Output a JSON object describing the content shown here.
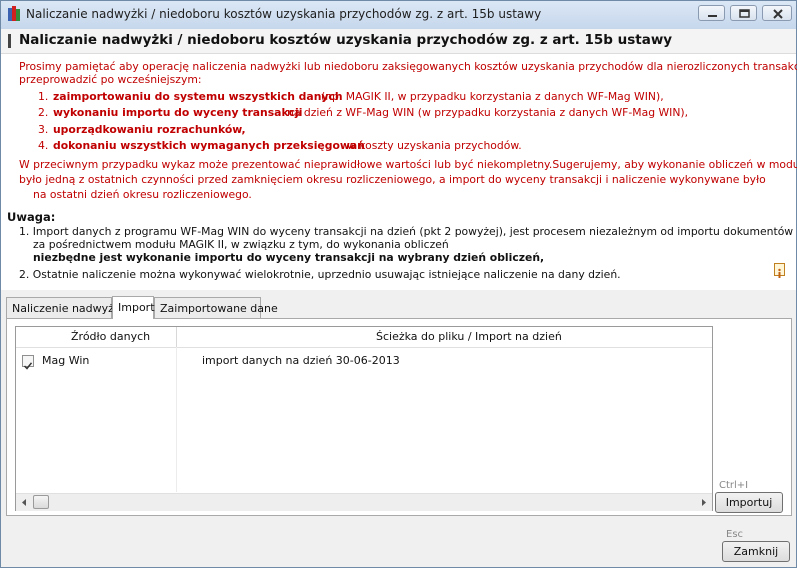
{
  "window": {
    "title": "Naliczanie nadwyżki / niedoboru kosztów uzyskania przychodów zg. z art. 15b ustawy"
  },
  "header": {
    "title": "Naliczanie nadwyżki / niedoboru kosztów uzyskania przychodów zg. z art. 15b ustawy"
  },
  "notice": {
    "intro_line1": "Prosimy pamiętać aby operację naliczenia nadwyżki lub niedoboru zaksięgowanych kosztów uzyskania przychodów dla nierozliczonych transakcji",
    "intro_line2": "przeprowadzić po wcześniejszym:",
    "items": [
      {
        "num": "1.",
        "bold": "zaimportowaniu do systemu wszystkich danych",
        "rest": "(np. MAGIK II, w przypadku korzystania z danych WF-Mag WIN),"
      },
      {
        "num": "2.",
        "bold": "wykonaniu importu do wyceny transakcji",
        "rest": "na dzień z WF-Mag WIN (w przypadku korzystania z danych WF-Mag WIN),"
      },
      {
        "num": "3.",
        "bold": "uporządkowaniu rozrachunków,",
        "rest": ""
      },
      {
        "num": "4.",
        "bold": "dokonaniu wszystkich wymaganych przeksięgowań",
        "rest": "w koszty uzyskania przychodów."
      }
    ],
    "warning_line1": "W przeciwnym przypadku wykaz może prezentować nieprawidłowe wartości lub być niekompletny.Sugerujemy, aby wykonanie obliczeń w module",
    "warning_line2": "było jedną z ostatnich czynności przed zamknięciem okresu rozliczeniowego, a import do wyceny transakcji i naliczenie wykonywane było",
    "warning_line3": "na ostatni dzień okresu rozliczeniowego."
  },
  "uwaga": {
    "title": "Uwaga:",
    "item1_line1": "1. Import danych z programu WF-Mag WIN do wyceny transakcji na dzień (pkt 2 powyżej), jest procesem niezależnym od importu dokumentów",
    "item1_line2": "za pośrednictwem modułu MAGIK II, w związku z tym, do wykonania obliczeń",
    "item1_line3": "niezbędne jest wykonanie importu do wyceny transakcji na wybrany dzień obliczeń,",
    "item2": "2. Ostatnie naliczenie można wykonywać wielokrotnie, uprzednio usuwając istniejące naliczenie na dany dzień."
  },
  "tabs": [
    {
      "label": "Naliczenie nadwyżki",
      "active": false
    },
    {
      "label": "Import",
      "active": true
    },
    {
      "label": "Zaimportowane dane",
      "active": false
    }
  ],
  "grid": {
    "columns": [
      "Źródło danych",
      "Ścieżka do pliku / Import na dzień"
    ],
    "rows": [
      {
        "checked": true,
        "source": "Mag Win",
        "path": "import danych na dzień 30-06-2013"
      }
    ]
  },
  "buttons": {
    "import_label": "Importuj",
    "import_shortcut": "Ctrl+I",
    "close_label": "Zamknij",
    "close_shortcut": "Esc"
  },
  "colors": {
    "notice_red": "#c00000",
    "title_bar": "#c6d7ec"
  },
  "icons": [
    "app-icon",
    "minimize-icon",
    "maximize-icon",
    "close-icon",
    "info-icon",
    "checkbox-icon",
    "scroll-left-icon",
    "scroll-right-icon"
  ]
}
